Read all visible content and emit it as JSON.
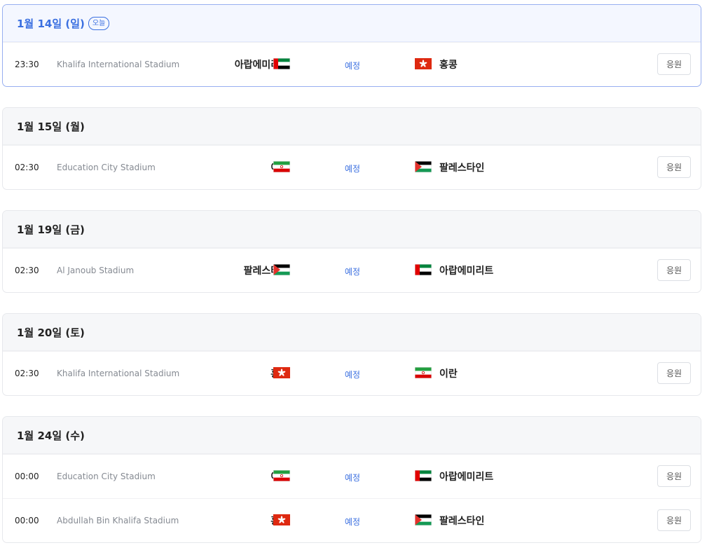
{
  "colors": {
    "accent": "#3a6fe0",
    "today_border": "#98aff0",
    "header_bg": "#f6f7f9",
    "venue_text": "#858a92"
  },
  "days": [
    {
      "title": "1월 14일 (일)",
      "today": true,
      "today_badge": "오늘",
      "matches": [
        {
          "time": "23:30",
          "venue": "Khalifa International Stadium",
          "home": "아랍에미리트",
          "home_flag": "uae-flag-icon",
          "status": "예정",
          "away": "홍콩",
          "away_flag": "hongkong-flag-icon",
          "cheer": "응원"
        }
      ]
    },
    {
      "title": "1월 15일 (월)",
      "today": false,
      "matches": [
        {
          "time": "02:30",
          "venue": "Education City Stadium",
          "home": "이란",
          "home_flag": "iran-flag-icon",
          "status": "예정",
          "away": "팔레스타인",
          "away_flag": "palestine-flag-icon",
          "cheer": "응원"
        }
      ]
    },
    {
      "title": "1월 19일 (금)",
      "today": false,
      "matches": [
        {
          "time": "02:30",
          "venue": "Al Janoub Stadium",
          "home": "팔레스타인",
          "home_flag": "palestine-flag-icon",
          "status": "예정",
          "away": "아랍에미리트",
          "away_flag": "uae-flag-icon",
          "cheer": "응원"
        }
      ]
    },
    {
      "title": "1월 20일 (토)",
      "today": false,
      "matches": [
        {
          "time": "02:30",
          "venue": "Khalifa International Stadium",
          "home": "홍콩",
          "home_flag": "hongkong-flag-icon",
          "status": "예정",
          "away": "이란",
          "away_flag": "iran-flag-icon",
          "cheer": "응원"
        }
      ]
    },
    {
      "title": "1월 24일 (수)",
      "today": false,
      "matches": [
        {
          "time": "00:00",
          "venue": "Education City Stadium",
          "home": "이란",
          "home_flag": "iran-flag-icon",
          "status": "예정",
          "away": "아랍에미리트",
          "away_flag": "uae-flag-icon",
          "cheer": "응원"
        },
        {
          "time": "00:00",
          "venue": "Abdullah Bin Khalifa Stadium",
          "home": "홍콩",
          "home_flag": "hongkong-flag-icon",
          "status": "예정",
          "away": "팔레스타인",
          "away_flag": "palestine-flag-icon",
          "cheer": "응원"
        }
      ]
    }
  ]
}
